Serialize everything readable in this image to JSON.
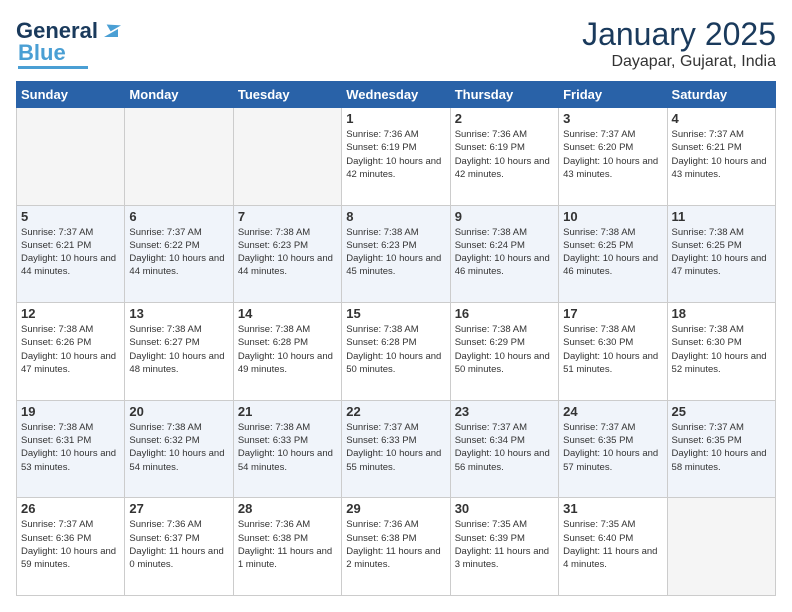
{
  "header": {
    "logo_general": "General",
    "logo_blue": "Blue",
    "month_title": "January 2025",
    "location": "Dayapar, Gujarat, India"
  },
  "days_of_week": [
    "Sunday",
    "Monday",
    "Tuesday",
    "Wednesday",
    "Thursday",
    "Friday",
    "Saturday"
  ],
  "weeks": [
    {
      "shade": false,
      "days": [
        {
          "num": "",
          "empty": true
        },
        {
          "num": "",
          "empty": true
        },
        {
          "num": "",
          "empty": true
        },
        {
          "num": "1",
          "sunrise": "7:36 AM",
          "sunset": "6:19 PM",
          "daylight": "10 hours and 42 minutes."
        },
        {
          "num": "2",
          "sunrise": "7:36 AM",
          "sunset": "6:19 PM",
          "daylight": "10 hours and 42 minutes."
        },
        {
          "num": "3",
          "sunrise": "7:37 AM",
          "sunset": "6:20 PM",
          "daylight": "10 hours and 43 minutes."
        },
        {
          "num": "4",
          "sunrise": "7:37 AM",
          "sunset": "6:21 PM",
          "daylight": "10 hours and 43 minutes."
        }
      ]
    },
    {
      "shade": true,
      "days": [
        {
          "num": "5",
          "sunrise": "7:37 AM",
          "sunset": "6:21 PM",
          "daylight": "10 hours and 44 minutes."
        },
        {
          "num": "6",
          "sunrise": "7:37 AM",
          "sunset": "6:22 PM",
          "daylight": "10 hours and 44 minutes."
        },
        {
          "num": "7",
          "sunrise": "7:38 AM",
          "sunset": "6:23 PM",
          "daylight": "10 hours and 44 minutes."
        },
        {
          "num": "8",
          "sunrise": "7:38 AM",
          "sunset": "6:23 PM",
          "daylight": "10 hours and 45 minutes."
        },
        {
          "num": "9",
          "sunrise": "7:38 AM",
          "sunset": "6:24 PM",
          "daylight": "10 hours and 46 minutes."
        },
        {
          "num": "10",
          "sunrise": "7:38 AM",
          "sunset": "6:25 PM",
          "daylight": "10 hours and 46 minutes."
        },
        {
          "num": "11",
          "sunrise": "7:38 AM",
          "sunset": "6:25 PM",
          "daylight": "10 hours and 47 minutes."
        }
      ]
    },
    {
      "shade": false,
      "days": [
        {
          "num": "12",
          "sunrise": "7:38 AM",
          "sunset": "6:26 PM",
          "daylight": "10 hours and 47 minutes."
        },
        {
          "num": "13",
          "sunrise": "7:38 AM",
          "sunset": "6:27 PM",
          "daylight": "10 hours and 48 minutes."
        },
        {
          "num": "14",
          "sunrise": "7:38 AM",
          "sunset": "6:28 PM",
          "daylight": "10 hours and 49 minutes."
        },
        {
          "num": "15",
          "sunrise": "7:38 AM",
          "sunset": "6:28 PM",
          "daylight": "10 hours and 50 minutes."
        },
        {
          "num": "16",
          "sunrise": "7:38 AM",
          "sunset": "6:29 PM",
          "daylight": "10 hours and 50 minutes."
        },
        {
          "num": "17",
          "sunrise": "7:38 AM",
          "sunset": "6:30 PM",
          "daylight": "10 hours and 51 minutes."
        },
        {
          "num": "18",
          "sunrise": "7:38 AM",
          "sunset": "6:30 PM",
          "daylight": "10 hours and 52 minutes."
        }
      ]
    },
    {
      "shade": true,
      "days": [
        {
          "num": "19",
          "sunrise": "7:38 AM",
          "sunset": "6:31 PM",
          "daylight": "10 hours and 53 minutes."
        },
        {
          "num": "20",
          "sunrise": "7:38 AM",
          "sunset": "6:32 PM",
          "daylight": "10 hours and 54 minutes."
        },
        {
          "num": "21",
          "sunrise": "7:38 AM",
          "sunset": "6:33 PM",
          "daylight": "10 hours and 54 minutes."
        },
        {
          "num": "22",
          "sunrise": "7:37 AM",
          "sunset": "6:33 PM",
          "daylight": "10 hours and 55 minutes."
        },
        {
          "num": "23",
          "sunrise": "7:37 AM",
          "sunset": "6:34 PM",
          "daylight": "10 hours and 56 minutes."
        },
        {
          "num": "24",
          "sunrise": "7:37 AM",
          "sunset": "6:35 PM",
          "daylight": "10 hours and 57 minutes."
        },
        {
          "num": "25",
          "sunrise": "7:37 AM",
          "sunset": "6:35 PM",
          "daylight": "10 hours and 58 minutes."
        }
      ]
    },
    {
      "shade": false,
      "days": [
        {
          "num": "26",
          "sunrise": "7:37 AM",
          "sunset": "6:36 PM",
          "daylight": "10 hours and 59 minutes."
        },
        {
          "num": "27",
          "sunrise": "7:36 AM",
          "sunset": "6:37 PM",
          "daylight": "11 hours and 0 minutes."
        },
        {
          "num": "28",
          "sunrise": "7:36 AM",
          "sunset": "6:38 PM",
          "daylight": "11 hours and 1 minute."
        },
        {
          "num": "29",
          "sunrise": "7:36 AM",
          "sunset": "6:38 PM",
          "daylight": "11 hours and 2 minutes."
        },
        {
          "num": "30",
          "sunrise": "7:35 AM",
          "sunset": "6:39 PM",
          "daylight": "11 hours and 3 minutes."
        },
        {
          "num": "31",
          "sunrise": "7:35 AM",
          "sunset": "6:40 PM",
          "daylight": "11 hours and 4 minutes."
        },
        {
          "num": "",
          "empty": true
        }
      ]
    }
  ],
  "labels": {
    "sunrise": "Sunrise:",
    "sunset": "Sunset:",
    "daylight": "Daylight:"
  }
}
